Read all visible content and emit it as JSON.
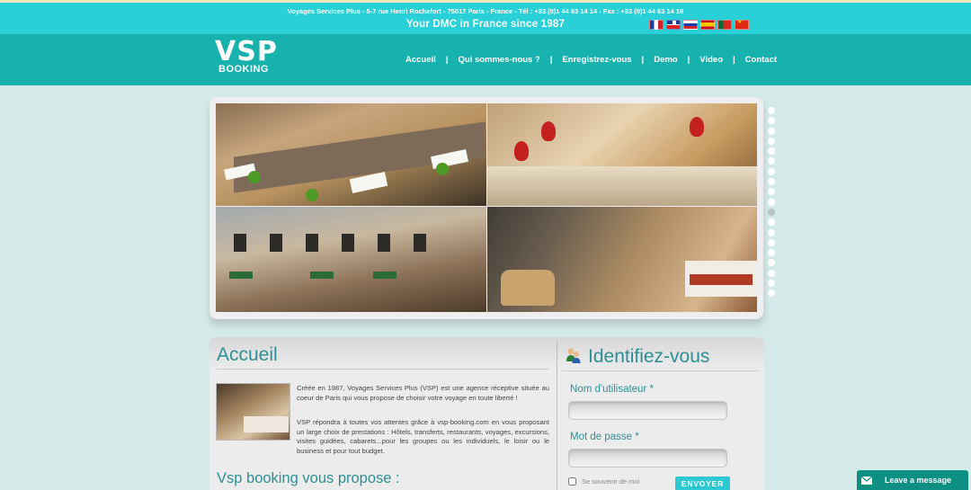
{
  "topbar": {
    "address": "Voyages Services Plus - 5-7 rue Henri Rochefort - 75017 Paris - France - Tél : +33 (0)1 44 63 14 14 - Fax : +33 (0)1 44 63 14 16",
    "tagline": "Your DMC in France since 1987",
    "languages": [
      "fr",
      "en",
      "ru",
      "es",
      "pt",
      "cn"
    ]
  },
  "logo": {
    "top": "VSP",
    "bottom": "BOOKING"
  },
  "nav": {
    "items": [
      "Accueil",
      "Qui sommes-nous ?",
      "Enregistrez-vous",
      "Demo",
      "Video",
      "Contact"
    ],
    "separator": "|"
  },
  "slider": {
    "dot_count": 19,
    "active_dot": 10
  },
  "main": {
    "title": "Accueil",
    "intro": "Créée en 1987, Voyages Services Plus (VSP) est une agence réceptive située au coeur de Paris qui vous propose de choisir votre voyage en toute liberté !",
    "body": "VSP répondra à toutes vos attentes grâce à vsp-booking.com en vous proposant un large choix de prestations : Hôtels, transferts, restaurants, voyages, excursions, visites guidées, cabarets...pour les groupes ou les individuels, le loisir ou le business et pour tout budget.",
    "subtitle": "Vsp booking vous propose :"
  },
  "login": {
    "title": "Identifiez-vous",
    "username_label": "Nom d'utilisateur *",
    "password_label": "Mot de passe *",
    "remember_label": "Se souvenir de moi",
    "submit_label": "ENVOYER"
  },
  "chat": {
    "label": "Leave a message"
  },
  "colors": {
    "topbar": "#2ad0d8",
    "navbar": "#17b2ae",
    "heading": "#2d8f96",
    "background": "#d3eae9"
  }
}
